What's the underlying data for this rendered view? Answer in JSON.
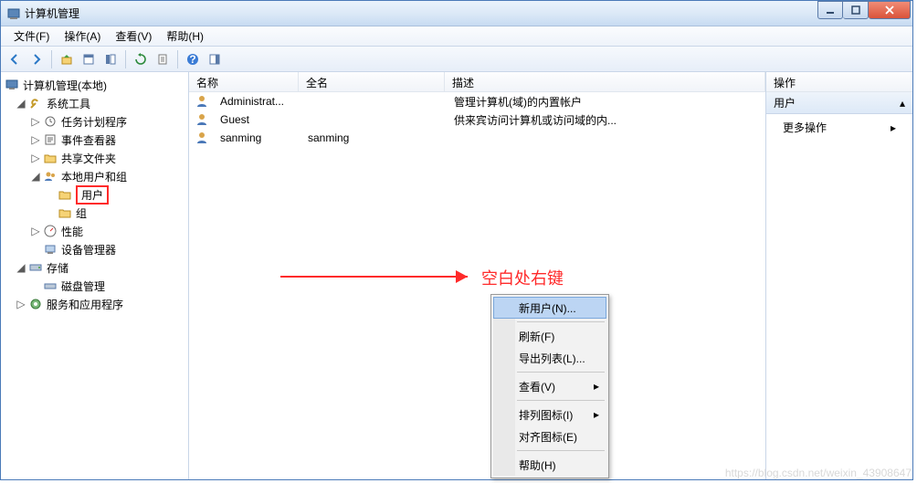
{
  "window": {
    "title": "计算机管理"
  },
  "menubar": [
    "文件(F)",
    "操作(A)",
    "查看(V)",
    "帮助(H)"
  ],
  "tree": {
    "root": "计算机管理(本地)",
    "systools": "系统工具",
    "task": "任务计划程序",
    "event": "事件查看器",
    "shared": "共享文件夹",
    "localusers": "本地用户和组",
    "users": "用户",
    "groups": "组",
    "perf": "性能",
    "devmgr": "设备管理器",
    "storage": "存储",
    "diskmgr": "磁盘管理",
    "services": "服务和应用程序"
  },
  "list": {
    "headers": {
      "name": "名称",
      "full": "全名",
      "desc": "描述"
    },
    "rows": [
      {
        "name": "Administrat...",
        "full": "",
        "desc": "管理计算机(域)的内置帐户"
      },
      {
        "name": "Guest",
        "full": "",
        "desc": "供来宾访问计算机或访问域的内..."
      },
      {
        "name": "sanming",
        "full": "sanming",
        "desc": ""
      }
    ]
  },
  "actions": {
    "header": "操作",
    "group": "用户",
    "more": "更多操作"
  },
  "contextmenu": {
    "newuser": "新用户(N)...",
    "refresh": "刷新(F)",
    "export": "导出列表(L)...",
    "view": "查看(V)",
    "arrange": "排列图标(I)",
    "align": "对齐图标(E)",
    "help": "帮助(H)"
  },
  "annotation": "空白处右键",
  "watermark": "https://blog.csdn.net/weixin_43908647"
}
